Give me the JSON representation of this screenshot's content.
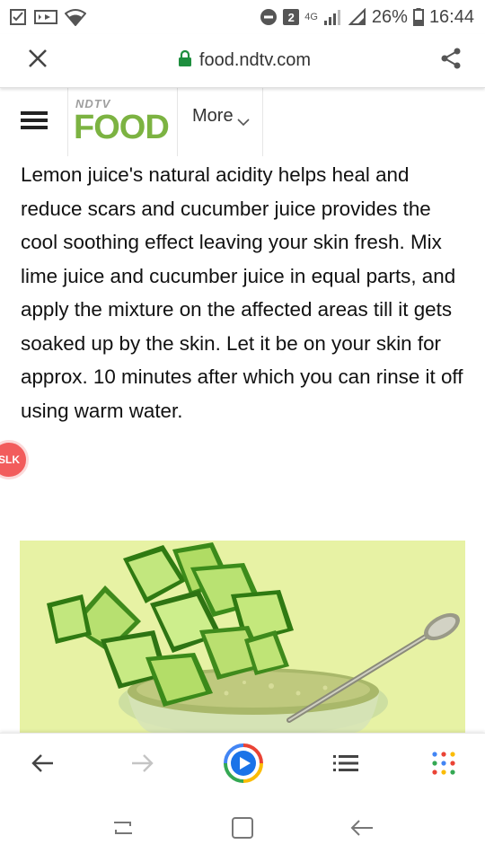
{
  "status_bar": {
    "network": "4G",
    "notification_count": "2",
    "battery_percent": "26%",
    "time": "16:44"
  },
  "browser": {
    "url": "food.ndtv.com"
  },
  "site_header": {
    "logo_small": "NDTV",
    "logo_main": "FOOD",
    "more_label": "More"
  },
  "article": {
    "paragraph": "Lemon juice's natural acidity helps heal and reduce scars and cucumber juice provides the cool soothing effect leaving your skin fresh. Mix lime juice and cucumber juice in equal parts, and apply the mixture on the affected areas till it gets soaked up by the skin. Let it be on your skin for approx. 10 minutes after which you can rinse it off using warm water.",
    "badge_text": "SLK"
  },
  "colors": {
    "brand_green": "#7cb342",
    "lock_green": "#1e8e3e",
    "image_bg": "#e7f2a4"
  },
  "bottom_nav": {
    "icons": [
      "back-arrow-icon",
      "forward-arrow-icon",
      "play-assistant-icon",
      "list-icon",
      "apps-grid-icon"
    ]
  }
}
